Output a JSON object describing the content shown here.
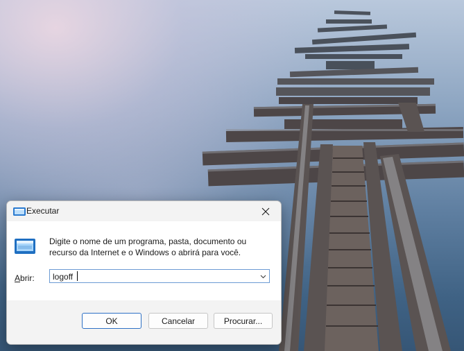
{
  "run_dialog": {
    "title": "Executar",
    "title_icon": "run-icon",
    "close_icon": "close-icon",
    "description": "Digite o nome de um programa, pasta, documento ou recurso da Internet e o Windows o abrirá para você.",
    "open_label_accel": "A",
    "open_label_rest": "brir:",
    "command_value": "logoff",
    "dropdown_icon": "chevron-down-icon",
    "buttons": {
      "ok": "OK",
      "cancel": "Cancelar",
      "browse": "Procurar..."
    }
  },
  "wallpaper": {
    "subject": "wooden pier over calm water",
    "sky_color": "#b9c8dc",
    "water_color": "#3f6284"
  },
  "colors": {
    "accent": "#2c6fc4",
    "dialog_bg": "#f3f3f3",
    "content_bg": "#ffffff"
  }
}
